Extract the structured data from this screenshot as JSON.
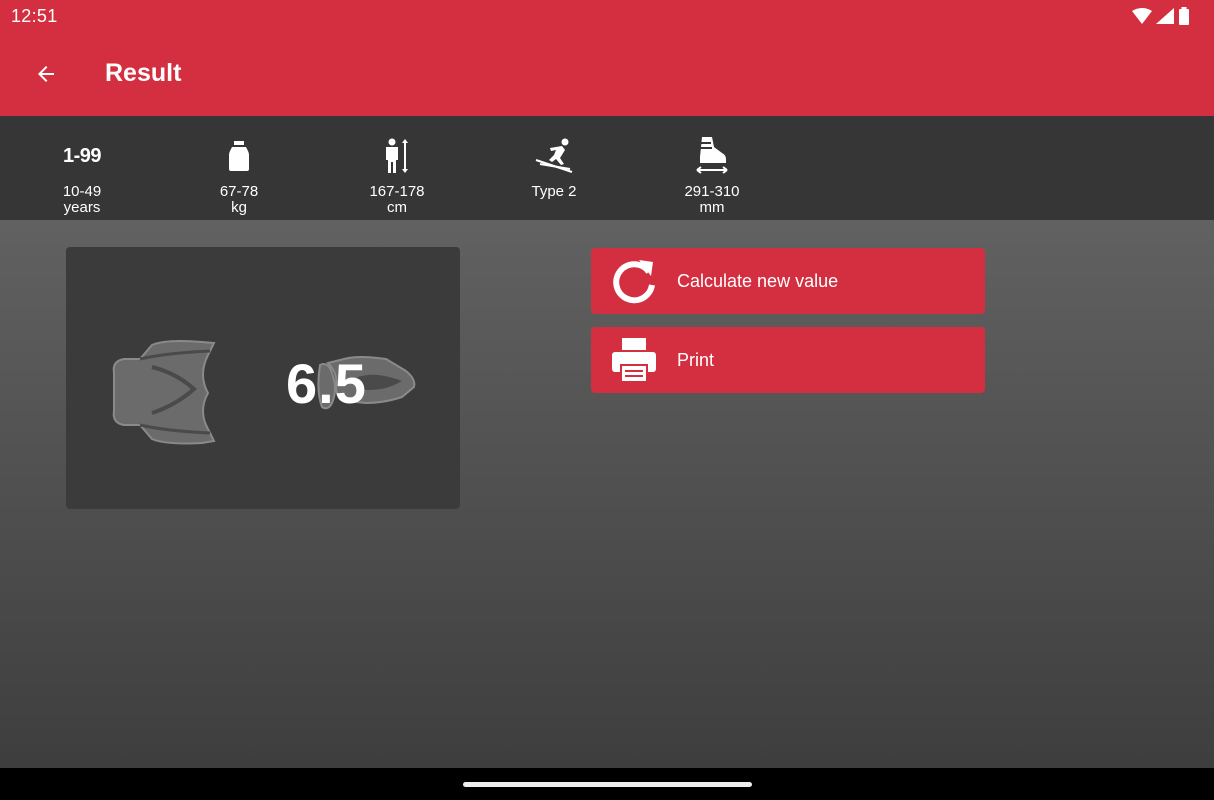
{
  "status_bar": {
    "time": "12:51",
    "icons": [
      "wifi-icon",
      "cell-signal-icon",
      "battery-icon"
    ]
  },
  "app_bar": {
    "title": "Result",
    "back_icon": "arrow-left-icon",
    "color": "#d42f40"
  },
  "summary": {
    "age": {
      "icon_label": "1-99",
      "line1": "10-49",
      "line2": "years"
    },
    "weight": {
      "icon": "weight-icon",
      "line1": "67-78",
      "line2": "kg"
    },
    "height": {
      "icon": "person-height-icon",
      "line1": "167-178",
      "line2": "cm"
    },
    "skier_type": {
      "icon": "skier-icon",
      "line1": "Type 2"
    },
    "boot_sole": {
      "icon": "ski-boot-icon",
      "line1": "291-310",
      "line2": "mm"
    }
  },
  "result": {
    "value": "6.5",
    "icon": "ski-binding-icon"
  },
  "actions": {
    "calculate_label": "Calculate new value",
    "calculate_icon": "refresh-icon",
    "print_label": "Print",
    "print_icon": "printer-icon"
  }
}
